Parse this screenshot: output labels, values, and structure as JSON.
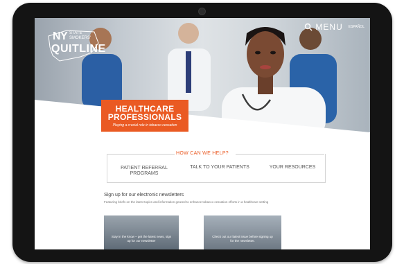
{
  "site": {
    "logo": {
      "ny": "NY",
      "small": "STATE SMOKERS'",
      "quitline": "QUITLINE"
    },
    "header": {
      "menu_label": "MENU",
      "language": "ESPAÑOL",
      "search_icon": "search-icon"
    },
    "hero": {
      "title": "HEALTHCARE PROFESSIONALS",
      "subtitle": "Playing a crucial role in tobacco cessation",
      "accent_color": "#ea5a23"
    },
    "help": {
      "heading": "HOW CAN WE HELP?",
      "links": [
        "PATIENT REFERRAL PROGRAMS",
        "TALK TO YOUR PATIENTS",
        "YOUR RESOURCES"
      ]
    },
    "newsletter": {
      "title": "Sign up for our electronic newsletters",
      "description": "Featuring briefs on the latest topics and information geared to enhance tobacco cessation efforts in a healthcare setting",
      "cards": [
        "Stay in the know – get the latest news, sign up for our newsletter",
        "Check out our latest issue before signing up for the newsletter."
      ]
    }
  }
}
